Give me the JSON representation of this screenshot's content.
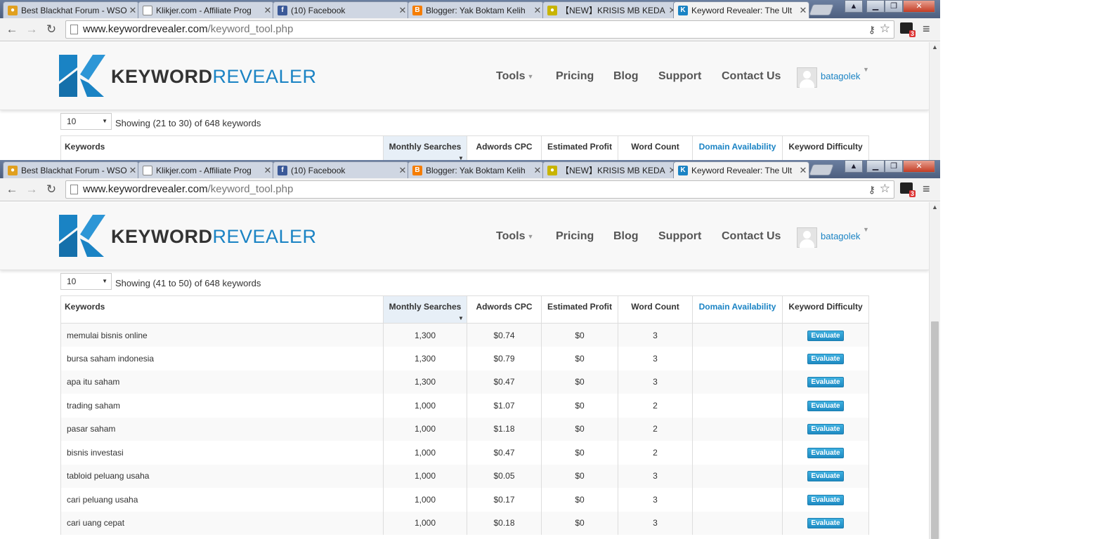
{
  "browser": {
    "tabs": [
      {
        "title": "Best Blackhat Forum - WSO",
        "fav_color": "#e0a020",
        "fav_glyph": "●"
      },
      {
        "title": "Klikjer.com - Affiliate Prog",
        "fav_color": "#ffffff",
        "fav_glyph": ""
      },
      {
        "title": "(10) Facebook",
        "fav_color": "#3b5998",
        "fav_glyph": "f"
      },
      {
        "title": "Blogger: Yak Boktam Kelih",
        "fav_color": "#f57d00",
        "fav_glyph": "B"
      },
      {
        "title": "【NEW】KRISIS MB KEDA",
        "fav_color": "#c8b400",
        "fav_glyph": "●"
      },
      {
        "title": "Keyword Revealer: The Ult",
        "fav_color": "#1a83c4",
        "fav_glyph": "K"
      }
    ],
    "url_host": "www.keywordrevealer.com",
    "url_path": "/keyword_tool.php",
    "extension_badge": "3"
  },
  "site": {
    "brand_bold": "KEYWORD",
    "brand_light": "REVEALER",
    "nav": [
      "Tools",
      "Pricing",
      "Blog",
      "Support",
      "Contact Us"
    ],
    "username": "batagolek"
  },
  "table": {
    "page_length": "10",
    "info_top": "Showing (21 to 30) of 648 keywords",
    "info_bottom": "Showing (41 to 50) of 648 keywords",
    "columns": [
      "Keywords",
      "Monthly Searches",
      "Adwords CPC",
      "Estimated Profit",
      "Word Count",
      "Domain Availability",
      "Keyword Difficulty"
    ],
    "button_label": "Evaluate",
    "rows": [
      {
        "keyword": "memulai bisnis online",
        "searches": "1,300",
        "cpc": "$0.74",
        "profit": "$0",
        "words": "3"
      },
      {
        "keyword": "bursa saham indonesia",
        "searches": "1,300",
        "cpc": "$0.79",
        "profit": "$0",
        "words": "3"
      },
      {
        "keyword": "apa itu saham",
        "searches": "1,300",
        "cpc": "$0.47",
        "profit": "$0",
        "words": "3"
      },
      {
        "keyword": "trading saham",
        "searches": "1,000",
        "cpc": "$1.07",
        "profit": "$0",
        "words": "2"
      },
      {
        "keyword": "pasar saham",
        "searches": "1,000",
        "cpc": "$1.18",
        "profit": "$0",
        "words": "2"
      },
      {
        "keyword": "bisnis investasi",
        "searches": "1,000",
        "cpc": "$0.47",
        "profit": "$0",
        "words": "2"
      },
      {
        "keyword": "tabloid peluang usaha",
        "searches": "1,000",
        "cpc": "$0.05",
        "profit": "$0",
        "words": "3"
      },
      {
        "keyword": "cari peluang usaha",
        "searches": "1,000",
        "cpc": "$0.17",
        "profit": "$0",
        "words": "3"
      },
      {
        "keyword": "cari uang cepat",
        "searches": "1,000",
        "cpc": "$0.18",
        "profit": "$0",
        "words": "3"
      }
    ]
  }
}
